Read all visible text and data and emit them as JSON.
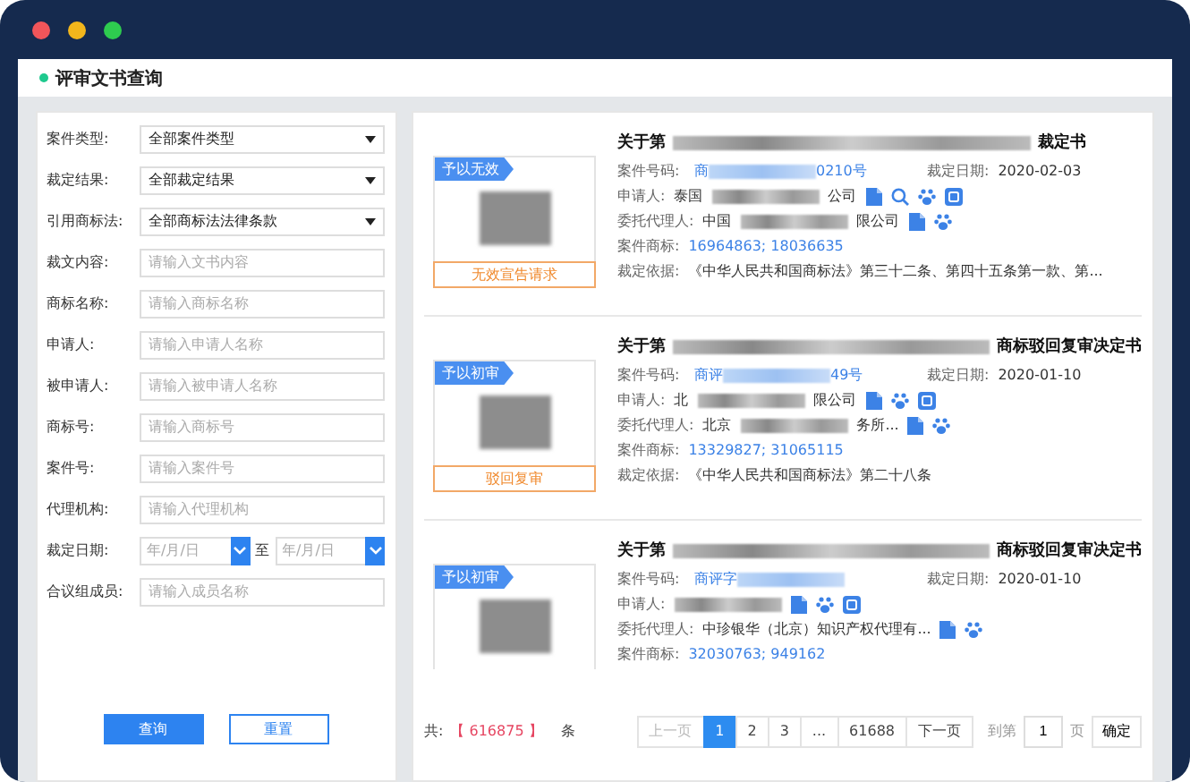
{
  "window": {
    "title": "评审文书查询"
  },
  "filters": [
    {
      "kind": "select",
      "label": "案件类型:",
      "value": "全部案件类型"
    },
    {
      "kind": "select",
      "label": "裁定结果:",
      "value": "全部裁定结果"
    },
    {
      "kind": "select",
      "label": "引用商标法:",
      "value": "全部商标法法律条款"
    },
    {
      "kind": "text",
      "label": "裁文内容:",
      "placeholder": "请输入文书内容"
    },
    {
      "kind": "text",
      "label": "商标名称:",
      "placeholder": "请输入商标名称"
    },
    {
      "kind": "text",
      "label": "申请人:",
      "placeholder": "请输入申请人名称"
    },
    {
      "kind": "text",
      "label": "被申请人:",
      "placeholder": "请输入被申请人名称"
    },
    {
      "kind": "text",
      "label": "商标号:",
      "placeholder": "请输入商标号"
    },
    {
      "kind": "text",
      "label": "案件号:",
      "placeholder": "请输入案件号"
    },
    {
      "kind": "text",
      "label": "代理机构:",
      "placeholder": "请输入代理机构"
    },
    {
      "kind": "daterange",
      "label": "裁定日期:",
      "placeholder": "年/月/日",
      "separator": "至",
      "placeholder_end": "年/月/日"
    },
    {
      "kind": "text",
      "label": "合议组成员:",
      "placeholder": "请输入成员名称"
    }
  ],
  "buttons": [
    {
      "label": "查询",
      "kind": "primary"
    },
    {
      "label": "重置",
      "kind": "secondary"
    }
  ],
  "results": [
    {
      "status": "予以无效",
      "bottom_label": "无效宣告请求",
      "title": [
        {
          "kind": "text",
          "text": "关于第"
        },
        {
          "kind": "blur"
        },
        {
          "kind": "text",
          "text": "裁定书"
        }
      ],
      "case_label": "案件号码:",
      "case_no": [
        {
          "kind": "text",
          "text": "商"
        },
        {
          "kind": "blur"
        },
        {
          "kind": "text",
          "text": "0210号"
        }
      ],
      "date_label": "裁定日期:",
      "date": "2020-02-03",
      "applicant_label": "申请人:",
      "applicant": [
        {
          "kind": "text",
          "text": "泰国"
        },
        {
          "kind": "blur"
        },
        {
          "kind": "text",
          "text": "公司"
        }
      ],
      "applicant_icons": [
        {
          "kind": "document"
        },
        {
          "kind": "search"
        },
        {
          "kind": "paw"
        },
        {
          "kind": "image"
        }
      ],
      "agent_label": "委托代理人:",
      "agent": [
        {
          "kind": "text",
          "text": "中国"
        },
        {
          "kind": "blur"
        },
        {
          "kind": "text",
          "text": "限公司"
        }
      ],
      "agent_icons": [
        {
          "kind": "document"
        },
        {
          "kind": "paw"
        }
      ],
      "marks_label": "案件商标:",
      "marks": "16964863; 18036635",
      "basis_label": "裁定依据:",
      "basis": "《中华人民共和国商标法》第三十二条、第四十五条第一款、第..."
    },
    {
      "status": "予以初审",
      "bottom_label": "驳回复审",
      "title": [
        {
          "kind": "text",
          "text": "关于第"
        },
        {
          "kind": "blur"
        },
        {
          "kind": "text",
          "text": "商标驳回复审决定书"
        }
      ],
      "case_label": "案件号码:",
      "case_no": [
        {
          "kind": "text",
          "text": "商评"
        },
        {
          "kind": "blur"
        },
        {
          "kind": "text",
          "text": "49号"
        }
      ],
      "date_label": "裁定日期:",
      "date": "2020-01-10",
      "applicant_label": "申请人:",
      "applicant": [
        {
          "kind": "text",
          "text": "北"
        },
        {
          "kind": "blur"
        },
        {
          "kind": "text",
          "text": "限公司"
        }
      ],
      "applicant_icons": [
        {
          "kind": "document"
        },
        {
          "kind": "paw"
        },
        {
          "kind": "image"
        }
      ],
      "agent_label": "委托代理人:",
      "agent": [
        {
          "kind": "text",
          "text": "北京"
        },
        {
          "kind": "blur"
        },
        {
          "kind": "text",
          "text": "务所..."
        }
      ],
      "agent_icons": [
        {
          "kind": "document"
        },
        {
          "kind": "paw"
        }
      ],
      "marks_label": "案件商标:",
      "marks": "13329827; 31065115",
      "basis_label": "裁定依据:",
      "basis": "《中华人民共和国商标法》第二十八条"
    },
    {
      "status": "予以初审",
      "title": [
        {
          "kind": "text",
          "text": "关于第"
        },
        {
          "kind": "blur"
        },
        {
          "kind": "text",
          "text": "商标驳回复审决定书"
        }
      ],
      "case_label": "案件号码:",
      "case_no": [
        {
          "kind": "text",
          "text": "商评字"
        },
        {
          "kind": "blur"
        }
      ],
      "date_label": "裁定日期:",
      "date": "2020-01-10",
      "applicant_label": "申请人:",
      "applicant": [
        {
          "kind": "blur"
        }
      ],
      "applicant_icons": [
        {
          "kind": "document"
        },
        {
          "kind": "paw"
        },
        {
          "kind": "image"
        }
      ],
      "agent_label": "委托代理人:",
      "agent": [
        {
          "kind": "text",
          "text": "中珍银华（北京）知识产权代理有..."
        }
      ],
      "agent_icons": [
        {
          "kind": "document"
        },
        {
          "kind": "paw"
        }
      ],
      "marks_label": "案件商标:",
      "marks": "32030763; 949162"
    }
  ],
  "pagination": {
    "total_label": "共:",
    "total": "【 616875 】",
    "total_unit": "条",
    "prev": {
      "label": "上一页",
      "disabled": true
    },
    "pages": [
      {
        "label": "1",
        "selected": true
      },
      {
        "label": "2",
        "selected": false
      },
      {
        "label": "3",
        "selected": false
      },
      {
        "label": "...",
        "selected": false
      },
      {
        "label": "61688",
        "selected": false
      }
    ],
    "next": {
      "label": "下一页",
      "disabled": false
    },
    "goto_label": "到第",
    "goto_value": "1",
    "goto_unit": "页",
    "confirm": "确定"
  }
}
